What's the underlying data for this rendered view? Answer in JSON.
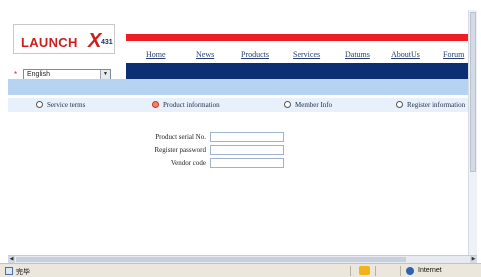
{
  "header": {
    "logo_text": "LAUNCH",
    "logo_x": "X",
    "logo_num": "431",
    "nav": [
      "Home",
      "News",
      "Products",
      "Services",
      "Datums",
      "AboutUs",
      "Forum"
    ]
  },
  "language": {
    "marker": "*",
    "selected": "English",
    "arrow": "▼"
  },
  "tabs": [
    {
      "label": "Service terms",
      "active": false
    },
    {
      "label": "Product information",
      "active": true
    },
    {
      "label": "Member Info",
      "active": false
    },
    {
      "label": "Register information",
      "active": false
    }
  ],
  "form": {
    "serial_label": "Product serial No.",
    "password_label": "Register password",
    "vendor_label": "Vendor code"
  },
  "scrollbar": {
    "left_arrow": "◀",
    "right_arrow": "▶"
  },
  "status": {
    "left_text": "完毕",
    "zone": "Internet"
  },
  "colors": {
    "red_bar": "#ee1c25",
    "blue_bar": "#0c2f73",
    "light_band": "#b6d3f2",
    "tab_strip": "#e8f1fb"
  }
}
